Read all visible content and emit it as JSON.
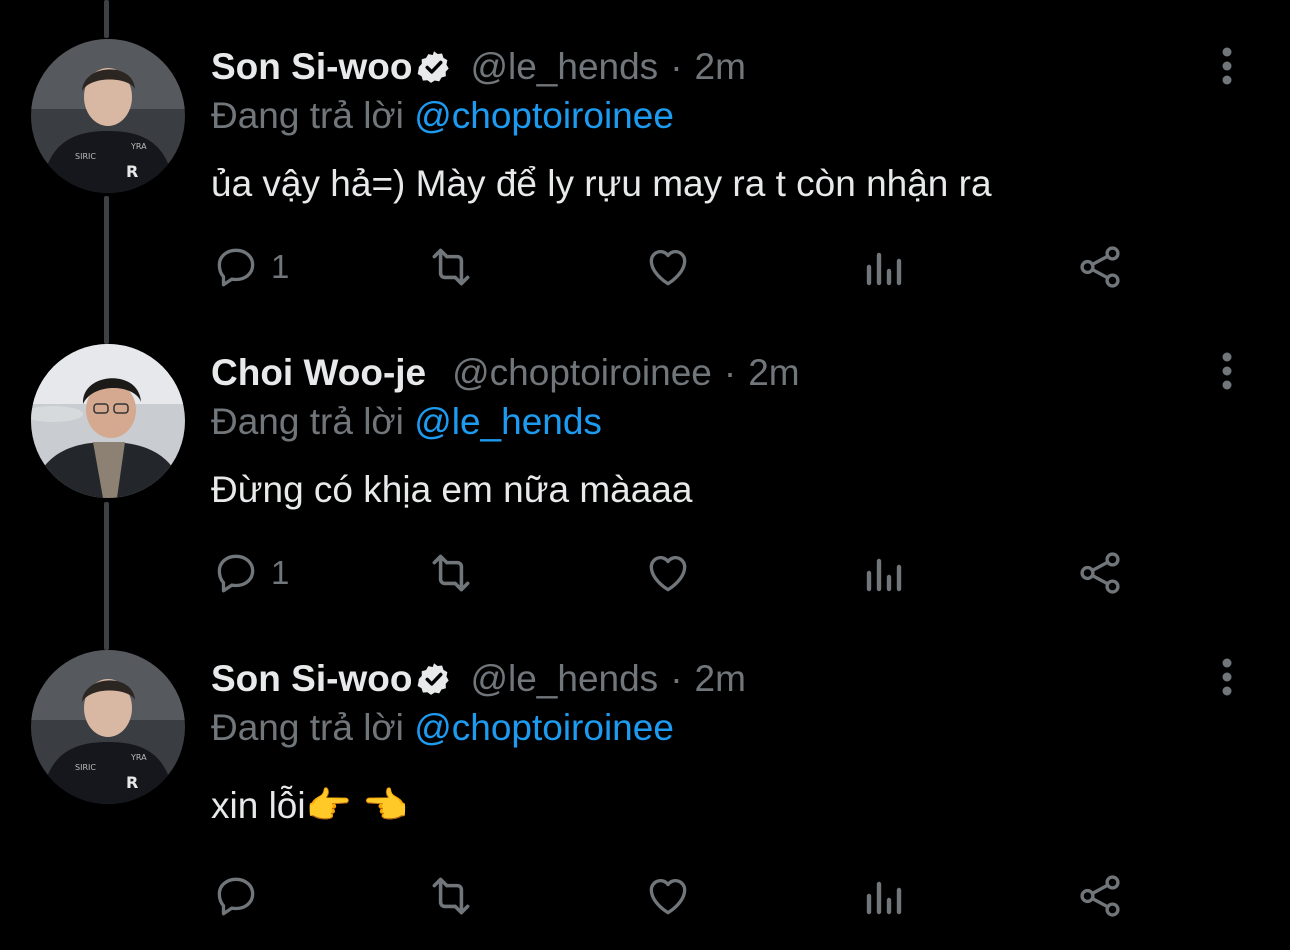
{
  "reply_prefix": "Đang trả lời",
  "colors": {
    "background": "#000000",
    "text": "#e7e9ea",
    "muted": "#71767b",
    "link": "#1d9bf0",
    "thread_line": "#3e4144"
  },
  "tweets": [
    {
      "name": "Son Si-woo",
      "verified": true,
      "handle": "@le_hends",
      "separator": "·",
      "time": "2m",
      "reply_to": "@choptoiroinee",
      "text": "ủa vậy hả=) Mày để ly rựu may ra t còn nhận ra",
      "reply_count": "1",
      "icons": [
        "reply-icon",
        "retweet-icon",
        "like-icon",
        "analytics-icon",
        "share-icon",
        "more-icon"
      ]
    },
    {
      "name": "Choi Woo-je",
      "verified": false,
      "handle": "@choptoiroinee",
      "separator": "·",
      "time": "2m",
      "reply_to": "@le_hends",
      "text": "Đừng có khịa em nữa màaaa",
      "reply_count": "1",
      "icons": [
        "reply-icon",
        "retweet-icon",
        "like-icon",
        "analytics-icon",
        "share-icon",
        "more-icon"
      ]
    },
    {
      "name": "Son Si-woo",
      "verified": true,
      "handle": "@le_hends",
      "separator": "·",
      "time": "2m",
      "reply_to": "@choptoiroinee",
      "text": "xin lỗi👉 👈",
      "reply_count": "",
      "icons": [
        "reply-icon",
        "retweet-icon",
        "like-icon",
        "analytics-icon",
        "share-icon",
        "more-icon"
      ]
    }
  ]
}
